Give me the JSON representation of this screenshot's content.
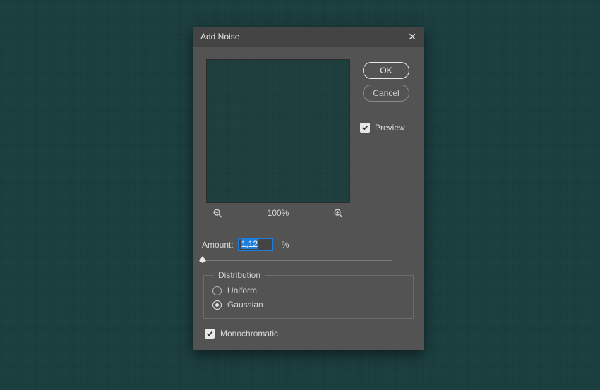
{
  "dialog": {
    "title": "Add Noise",
    "ok_label": "OK",
    "cancel_label": "Cancel",
    "preview_label": "Preview",
    "preview_checked": true,
    "zoom_level": "100%",
    "amount": {
      "label": "Amount:",
      "value": "1,12",
      "unit": "%"
    },
    "distribution": {
      "legend": "Distribution",
      "options": [
        {
          "label": "Uniform",
          "selected": false
        },
        {
          "label": "Gaussian",
          "selected": true
        }
      ]
    },
    "monochromatic": {
      "label": "Monochromatic",
      "checked": true
    }
  },
  "colors": {
    "background": "#1a3d3e",
    "dialog_bg": "#535353",
    "titlebar_bg": "#444444",
    "focus_border": "#1d7fdb"
  }
}
